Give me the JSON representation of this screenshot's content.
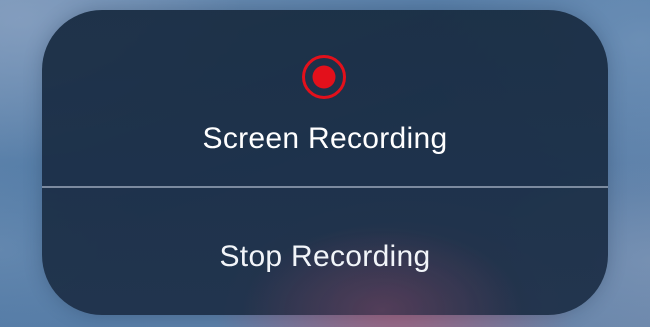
{
  "panel": {
    "title": "Screen Recording",
    "record_icon": "record-icon",
    "stop_label": "Stop Recording"
  },
  "colors": {
    "record_red": "#e3101b",
    "panel_bg": "#1b2e46",
    "text": "#ffffff"
  }
}
